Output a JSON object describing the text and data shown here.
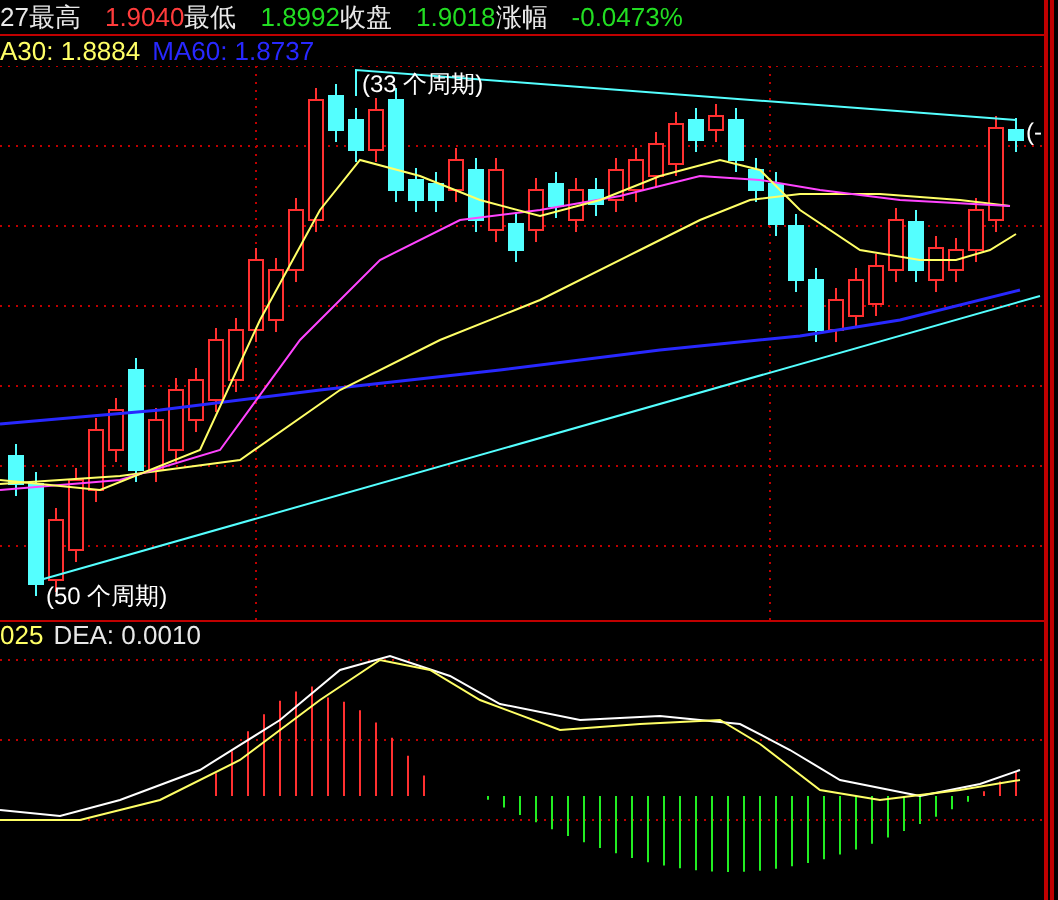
{
  "quote_bar": [
    {
      "text": "27最高",
      "color": "#e8e8e8"
    },
    {
      "text": "1.9040",
      "color": "#ff3c3c"
    },
    {
      "text": "最低",
      "color": "#e8e8e8"
    },
    {
      "text": "1.8992",
      "color": "#22dd22"
    },
    {
      "text": "收盘",
      "color": "#e8e8e8"
    },
    {
      "text": "1.9018",
      "color": "#22dd22"
    },
    {
      "text": "涨幅",
      "color": "#e8e8e8"
    },
    {
      "text": "-0.0473%",
      "color": "#22dd22"
    }
  ],
  "ma_legend": [
    {
      "text": "A30: 1.8884",
      "color": "#ffff66"
    },
    {
      "text": "MA60: 1.8737",
      "color": "#2828ff"
    }
  ],
  "price_chart": {
    "annotations": [
      {
        "text": "(33 个周期)"
      },
      {
        "text": "(50 个周期)"
      },
      {
        "text": "(-"
      }
    ]
  },
  "macd_legend": [
    {
      "text": "025",
      "color": "#ffff66"
    },
    {
      "text": "DEA: 0.0010",
      "color": "#e8e8e8"
    }
  ]
}
